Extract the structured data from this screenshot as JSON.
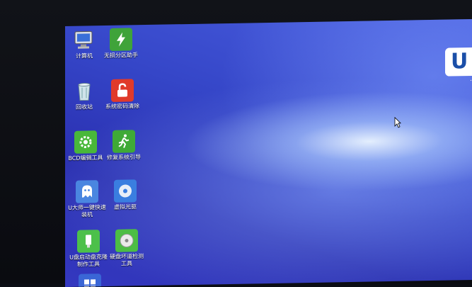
{
  "desktop": {
    "icons": [
      {
        "id": "computer",
        "label": "计算机",
        "icon": "computer-icon"
      },
      {
        "id": "partition",
        "label": "无损分区助手",
        "icon": "partition-tool-icon"
      },
      {
        "id": "recycle",
        "label": "回收站",
        "icon": "recycle-bin-icon"
      },
      {
        "id": "password",
        "label": "系统密码清除",
        "icon": "lock-icon"
      },
      {
        "id": "bcd",
        "label": "BCD编辑工具",
        "icon": "gear-icon"
      },
      {
        "id": "boot",
        "label": "修复系统引导",
        "icon": "running-man-icon"
      },
      {
        "id": "uinstall",
        "label": "U大师一键快速装机",
        "icon": "ghost-icon"
      },
      {
        "id": "vdrive",
        "label": "虚拟光驱",
        "icon": "disc-icon"
      },
      {
        "id": "uboot",
        "label": "U盘启动盘克隆制作工具",
        "icon": "usb-icon"
      },
      {
        "id": "disk",
        "label": "硬盘坏道检测工具",
        "icon": "harddisk-icon"
      },
      {
        "id": "windows",
        "label": "",
        "icon": "windows-icon"
      }
    ]
  },
  "brand": {
    "logo_letter": "U",
    "sub": "."
  },
  "colors": {
    "accent": "#1b4fa8",
    "desktop_blue": "#3546c8"
  }
}
